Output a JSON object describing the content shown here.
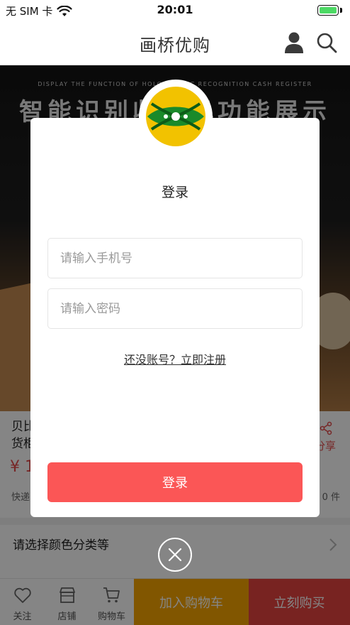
{
  "status_bar": {
    "carrier": "无 SIM 卡",
    "time": "20:01"
  },
  "nav": {
    "title": "画桥优购",
    "user_icon": "user-icon",
    "search_icon": "search-icon"
  },
  "banner": {
    "subtitle": "DISPLAY THE FUNCTION OF HOLOGRAPHIC RECOGNITION CASH REGISTER",
    "title": "智能识别收银机功能展示"
  },
  "product": {
    "name": "贝比\n货柜",
    "price": "¥ 1",
    "shipping": "快递",
    "stock": "0 件",
    "share_label": "分享"
  },
  "options": {
    "label": "请选择颜色分类等"
  },
  "bottom_bar": {
    "items": [
      {
        "label": "关注",
        "icon": "heart-icon"
      },
      {
        "label": "店铺",
        "icon": "store-icon"
      },
      {
        "label": "购物车",
        "icon": "cart-icon"
      }
    ],
    "add_cart": "加入购物车",
    "buy_now": "立刻购买"
  },
  "login": {
    "title": "登录",
    "phone_placeholder": "请输入手机号",
    "password_placeholder": "请输入密码",
    "register_link": "还没账号？立即注册",
    "submit_label": "登录"
  },
  "colors": {
    "accent": "#fb5656",
    "logo_yellow": "#f2c200",
    "logo_green": "#1a8a2a"
  }
}
